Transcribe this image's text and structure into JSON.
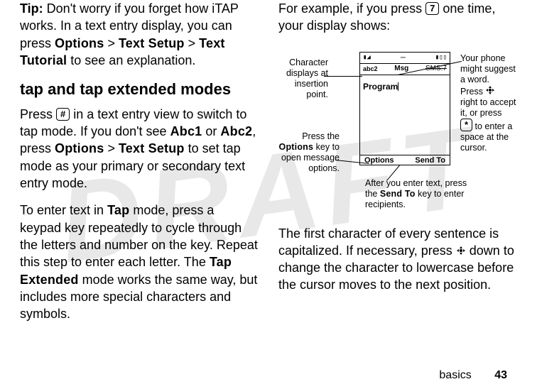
{
  "watermark": "DRAFT",
  "left": {
    "tip_label": "Tip:",
    "tip_body_1": " Don't worry if you forget how iTAP works. In a text entry display, you can press ",
    "tip_path_1": "Options",
    "gt1": " > ",
    "tip_path_2": "Text Setup",
    "gt2": " > ",
    "tip_path_3": "Text Tutorial",
    "tip_body_2": " to see an explanation.",
    "heading": "tap and tap extended modes",
    "p2_a": "Press ",
    "key_hash": "#",
    "p2_b": " in a text entry view to switch to tap mode. If you don't see ",
    "abc1": "Abc1",
    "p2_or": " or ",
    "abc2": "Abc2",
    "p2_c": ", press ",
    "opt": "Options",
    "gt3": " > ",
    "ts": "Text Setup",
    "p2_d": " to set tap mode as your primary or secondary text entry mode.",
    "p3_a": "To enter text in ",
    "tap": "Tap",
    "p3_b": " mode, press a keypad key repeatedly to cycle through the letters and number on the key. Repeat this step to enter each letter. The ",
    "tapext": "Tap Extended",
    "p3_c": " mode works the same way, but includes more special characters and symbols."
  },
  "right": {
    "p1_a": "For example, if you press ",
    "key7": "7",
    "p1_b": " one time, your display shows:",
    "p2": "The first character of every sentence is capitalized. If necessary, press ",
    "p2_b": " down to change the character to lowercase before the cursor moves to the next position."
  },
  "phone": {
    "abc": "abc2",
    "title": "Msg",
    "sms": "SMS:7",
    "word": "Program",
    "sk_left": "Options",
    "sk_right": "Send To"
  },
  "annots": {
    "char1": "Character",
    "char2": "displays at",
    "char3": "insertion",
    "char4": "point.",
    "left2a": "Press the",
    "left2b": "Options",
    "left2c": " key to",
    "left2d": "open message",
    "left2e": "options.",
    "right1a": "Your phone",
    "right1b": "might suggest",
    "right1c": "a word.",
    "right1d": "Press ",
    "right1e": "right to accept",
    "right1f": "it, or press",
    "right1g": " to enter a",
    "right1g_key": "*",
    "right1h": "space at the",
    "right1i": "cursor.",
    "bottom1": "After you enter text, press",
    "bottom2a": "the ",
    "bottom2b": "Send To",
    "bottom2c": " key to enter",
    "bottom3": "recipients."
  },
  "footer": {
    "section": "basics",
    "page": "43"
  }
}
